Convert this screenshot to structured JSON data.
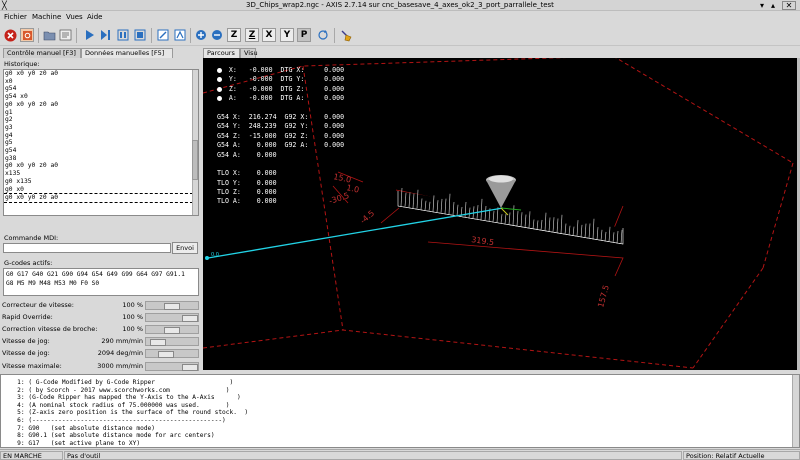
{
  "window": {
    "title": "3D_Chips_wrap2.ngc - AXIS 2.7.14 sur cnc_basesave_4_axes_ok2_3_port_parrallele_test"
  },
  "menu": [
    "Fichier",
    "Machine",
    "Vues",
    "Aide"
  ],
  "left_tabs": [
    "Contrôle manuel [F3]",
    "Données manuelles [F5]"
  ],
  "history": {
    "label": "Historique:",
    "lines": [
      "g0 x0 y0 z0 a0",
      "x0",
      "g54",
      "g54 x0",
      "g0 x0 y0 z0 a0",
      "g1",
      "g2",
      "g3",
      "g4",
      "g5",
      "g54",
      "g38",
      "g0 x0 y0 z0 a0",
      "x135",
      "g0 x135",
      "g0 x0",
      "g0 x0 y0 z0 a0"
    ]
  },
  "mdi": {
    "label": "Commande MDI:",
    "value": "",
    "send_label": "Envoi"
  },
  "gcodes": {
    "label": "G-codes actifs:",
    "line1": "G0 G17 G40 G21 G90 G94 G54 G49 G99 G64 G97 G91.1",
    "line2": "G8 M5 M9 M48 M53 M0 F0 S0"
  },
  "sliders": [
    {
      "label": "Correcteur de vitesse:",
      "value": "100 %",
      "level": 0.5
    },
    {
      "label": "Rapid Override:",
      "value": "100 %",
      "level": 1.0
    },
    {
      "label": "Correction vitesse de broche:",
      "value": "100 %",
      "level": 0.5
    },
    {
      "label": "Vitesse de jog:",
      "value": "290 mm/min",
      "level": 0.1
    },
    {
      "label": "Vitesse de jog:",
      "value": "2094 deg/min",
      "level": 0.32
    },
    {
      "label": "Vitesse maximale:",
      "value": "3000 mm/min",
      "level": 1.0
    }
  ],
  "right_tabs": [
    "Parcours d'outil",
    "Visu"
  ],
  "dro": {
    "lines": [
      "   X:   -0.000  DTG X:     0.000",
      "   Y:   -0.000  DTG Y:     0.000",
      "   Z:   -0.000  DTG Z:     0.000",
      "   A:   -0.000  DTG A:     0.000",
      "",
      "G54 X:  216.274  G92 X:    0.000",
      "G54 Y:  248.239  G92 Y:    0.000",
      "G54 Z:  -15.000  G92 Z:    0.000",
      "G54 A:    0.000  G92 A:    0.000",
      "G54 A:    0.000",
      "",
      "TLO X:    0.000",
      "TLO Y:    0.000",
      "TLO Z:    0.000",
      "TLO A:    0.000"
    ]
  },
  "preview_labels": {
    "dim1": "15.0",
    "dim2": "1.0",
    "dim3": "-30.5",
    "dim4": "-4.5",
    "dim5": "319.5",
    "dim6": "157.5"
  },
  "code": {
    "lines": [
      "   1: ( G-Code Modified by G-Code Ripper                    )",
      "   2: ( by Scorch - 2017 www.scorchworks.com               )",
      "   3: (G-Code Ripper has mapped the Y-Axis to the A-Axis      )",
      "   4: (A nominal stock radius of 75.000000 was used.       )",
      "   5: (Z-axis zero position is the surface of the round stock.  )",
      "   6: (---------------------------------------------------)",
      "   7: G90   (set absolute distance mode)",
      "   8: G90.1 (set absolute distance mode for arc centers)",
      "   9: G17   (set active plane to XY)"
    ]
  },
  "status": {
    "state": "EN MARCHE",
    "tool": "Pas d'outil",
    "position": "Position: Relatif Actuelle"
  },
  "colors": {
    "preview_bg": "#000000",
    "limits": "#b31414",
    "toolpath": "#ffffff",
    "rapid": "#22d3e6",
    "tool": "#cccccc"
  }
}
